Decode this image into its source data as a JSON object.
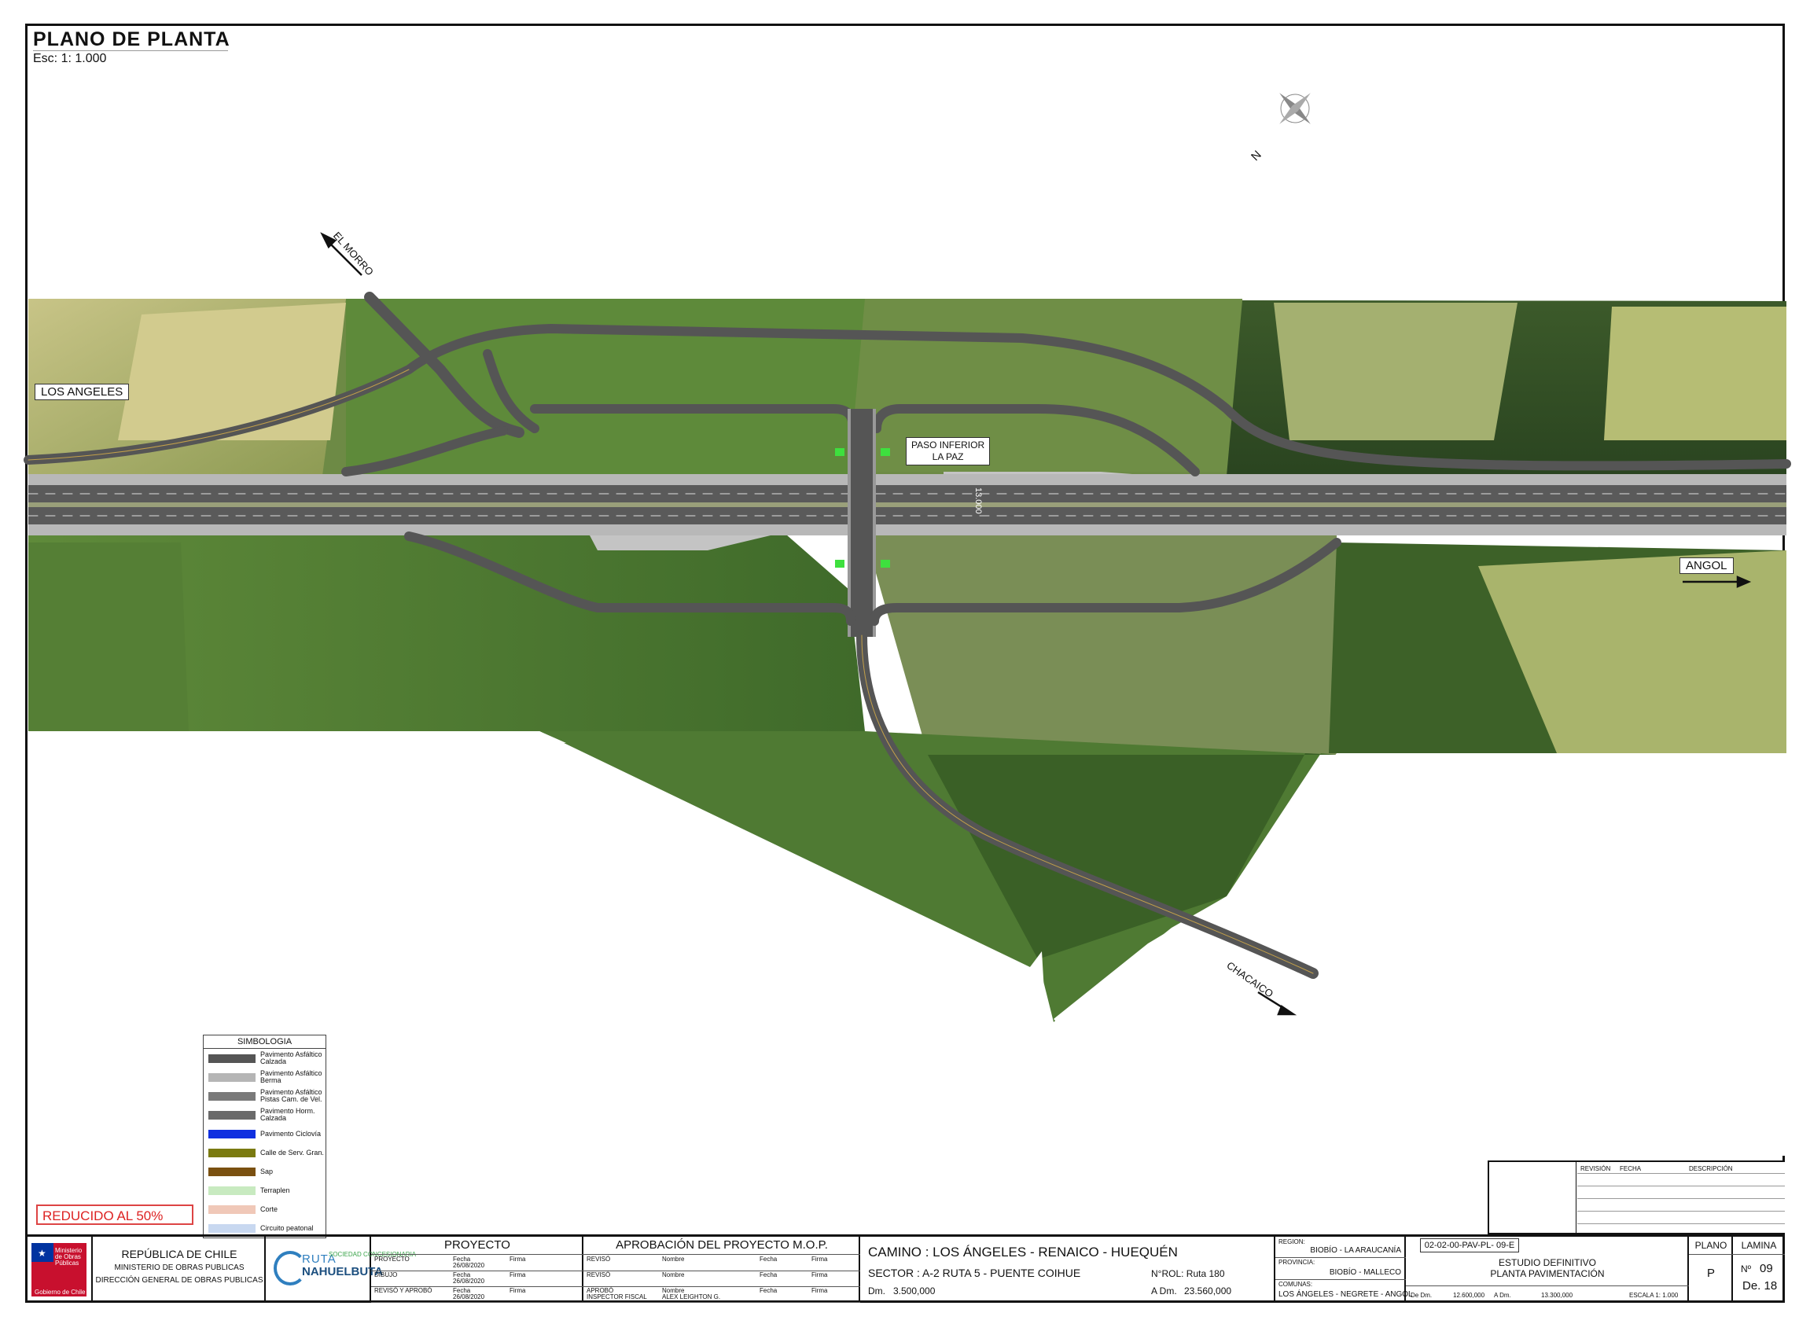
{
  "header": {
    "title": "PLANO DE PLANTA",
    "scale": "Esc: 1: 1.000"
  },
  "north_label": "N",
  "map_labels": {
    "el_morro": "EL MORRO",
    "los_angeles": "LOS ANGELES",
    "paso_inferior_1": "PASO INFERIOR",
    "paso_inferior_2": "LA PAZ",
    "chainage": "13.000",
    "angol": "ANGOL",
    "chacaico": "CHACAICO"
  },
  "legend": {
    "title": "SIMBOLOGIA",
    "items": [
      {
        "label1": "Pavimento Asfáltico",
        "label2": "Calzada",
        "color": "#555555"
      },
      {
        "label1": "Pavimento Asfáltico",
        "label2": "Berma",
        "color": "#b5b5b5"
      },
      {
        "label1": "Pavimento Asfáltico",
        "label2": "Pistas Cam. de Vel.",
        "color": "#7a7a7a"
      },
      {
        "label1": "Pavimento Horm.",
        "label2": "Calzada",
        "color": "#6a6a6a"
      },
      {
        "label1": "Pavimento Ciclovía",
        "label2": "",
        "color": "#1030e0"
      },
      {
        "label1": "Calle de Serv. Gran.",
        "label2": "",
        "color": "#7a7a10"
      },
      {
        "label1": "Sap",
        "label2": "",
        "color": "#7a5010"
      },
      {
        "label1": "Terraplen",
        "label2": "",
        "color": "#c8eac0"
      },
      {
        "label1": "Corte",
        "label2": "",
        "color": "#f0c8b8"
      },
      {
        "label1": "Circuito peatonal",
        "label2": "",
        "color": "#c8d8f0"
      }
    ]
  },
  "reduced_note": "REDUCIDO AL 50%",
  "revision": {
    "col1": "REVISIÓN",
    "col2": "FECHA",
    "col3": "DESCRIPCIÓN"
  },
  "title_block": {
    "logo_text": "Ministerio de Obras Públicas",
    "logo_sub": "Gobierno de Chile",
    "republic": "REPÚBLICA DE CHILE",
    "ministry": "MINISTERIO DE OBRAS PUBLICAS",
    "direction": "DIRECCIÓN GENERAL DE OBRAS PUBLICAS",
    "concession_1": "RUTA",
    "concession_2": "NAHUELBUTA",
    "concession_3": "SOCIEDAD CONCESIONARIA",
    "proyecto_header": "PROYECTO",
    "proyecto_rows": [
      {
        "role": "PROYECTO",
        "fecha_label": "Fecha",
        "fecha": "26/08/2020",
        "firma": "Firma"
      },
      {
        "role": "DIBUJO",
        "fecha_label": "Fecha",
        "fecha": "26/08/2020",
        "firma": "Firma"
      },
      {
        "role": "REVISÓ Y APROBÓ",
        "fecha_label": "Fecha",
        "fecha": "26/08/2020",
        "firma": "Firma"
      }
    ],
    "mop_header": "APROBACIÓN DEL PROYECTO M.O.P.",
    "mop_rows": [
      {
        "role": "REVISÓ",
        "nombre_label": "Nombre",
        "nombre": "",
        "fecha": "Fecha",
        "firma": "Firma"
      },
      {
        "role": "REVISÓ",
        "nombre_label": "Nombre",
        "nombre": "",
        "fecha": "Fecha",
        "firma": "Firma"
      },
      {
        "role": "APROBÓ",
        "role2": "INSPECTOR FISCAL",
        "nombre_label": "Nombre",
        "nombre": "ALEX LEIGHTON G.",
        "fecha": "Fecha",
        "firma": "Firma"
      }
    ],
    "camino": "CAMINO : LOS ÁNGELES - RENAICO - HUEQUÉN",
    "sector": "SECTOR : A-2  RUTA 5 - PUENTE COIHUE",
    "rol": "N°ROL: Ruta 180",
    "dm_label": "Dm.",
    "dm": "3.500,000",
    "adm_label": "A Dm.",
    "adm": "23.560,000",
    "region_label": "REGION:",
    "region": "BIOBÍO - LA ARAUCANÍA",
    "provincia_label": "PROVINCIA:",
    "provincia": "BIOBÍO - MALLECO",
    "comunas_label": "COMUNAS:",
    "comunas": "LOS ÁNGELES - NEGRETE - ANGOL",
    "code": "02-02-00-PAV-PL- 09-E",
    "estudio_1": "ESTUDIO DEFINITIVO",
    "estudio_2": "PLANTA PAVIMENTACIÓN",
    "dedm_label": "De Dm.",
    "dedm": "12.600,000",
    "adm2_label": "A Dm.",
    "adm2": "13.300,000",
    "escala": "ESCALA  1: 1.000",
    "plano_label": "PLANO",
    "plano": "P",
    "lamina_label": "LAMINA",
    "lamina_no_label": "Nº",
    "lamina_no": "09",
    "lamina_de": "De. 18"
  }
}
